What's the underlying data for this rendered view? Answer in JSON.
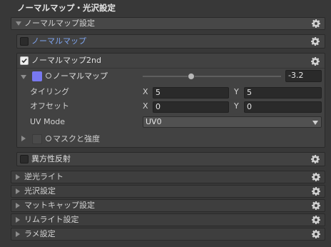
{
  "header": {
    "title": "ノーマルマップ・光沢設定"
  },
  "normal_section": {
    "label": "ノーマルマップ設定"
  },
  "normal_map_toggle": {
    "label": "ノーマルマップ"
  },
  "normal_map_2nd": {
    "label": "ノーマルマップ2nd",
    "texture_label": "ノーマルマップ",
    "swatch_color": "#7878f0",
    "strength_value": "-3.2",
    "slider_fraction": 0.35,
    "tiling_label": "タイリング",
    "tiling_x": "5",
    "tiling_y": "5",
    "offset_label": "オフセット",
    "offset_x": "0",
    "offset_y": "0",
    "x_label": "X",
    "y_label": "Y",
    "uv_mode_label": "UV Mode",
    "uv_mode_value": "UV0",
    "mask_label": "マスクと強度"
  },
  "anisotropy": {
    "label": "異方性反射"
  },
  "sections": [
    {
      "label": "逆光ライト"
    },
    {
      "label": "光沢設定"
    },
    {
      "label": "マットキャップ設定"
    },
    {
      "label": "リムライト設定"
    },
    {
      "label": "ラメ設定"
    }
  ],
  "icons": {
    "gear": "gear-icon",
    "check": "check-icon",
    "expand": "triangle-right-icon",
    "collapse": "triangle-down-icon"
  }
}
